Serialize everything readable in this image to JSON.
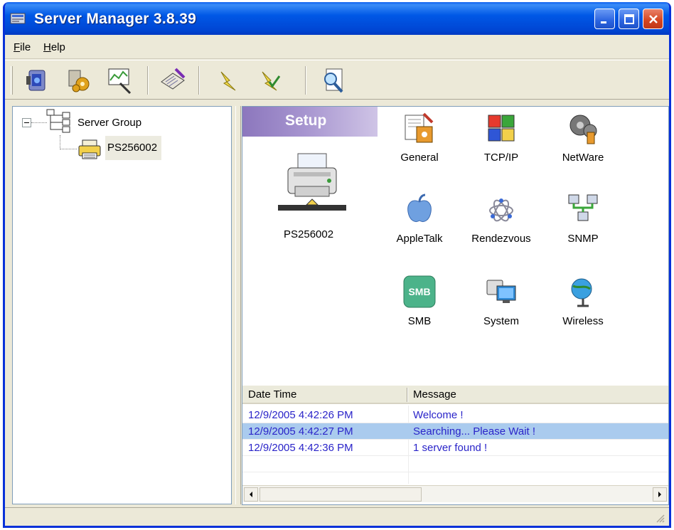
{
  "window": {
    "title": "Server Manager 3.8.39"
  },
  "menu": {
    "file_label": "File",
    "file_mnemonic": "F",
    "file_rest": "ile",
    "help_label": "Help",
    "help_mnemonic": "H",
    "help_rest": "elp"
  },
  "toolbar": {
    "tools": [
      "connect-icon",
      "config-icon",
      "monitor-icon",
      "print-queue-icon",
      "flash-icon",
      "flash-check-icon",
      "search-icon"
    ]
  },
  "tree": {
    "group_label": "Server Group",
    "server_label": "PS256002"
  },
  "setup": {
    "banner": "Setup",
    "server_name": "PS256002",
    "items": [
      {
        "label": "General",
        "icon": "general-icon"
      },
      {
        "label": "TCP/IP",
        "icon": "tcpip-icon"
      },
      {
        "label": "NetWare",
        "icon": "netware-icon"
      },
      {
        "label": "AppleTalk",
        "icon": "appletalk-icon"
      },
      {
        "label": "Rendezvous",
        "icon": "rendezvous-icon"
      },
      {
        "label": "SNMP",
        "icon": "snmp-icon"
      },
      {
        "label": "SMB",
        "icon": "smb-icon"
      },
      {
        "label": "System",
        "icon": "system-icon"
      },
      {
        "label": "Wireless",
        "icon": "wireless-icon"
      }
    ],
    "smb_icon_text": "SMB"
  },
  "log": {
    "columns": [
      "Date Time",
      "Message"
    ],
    "rows": [
      {
        "datetime": "12/9/2005 4:42:26 PM",
        "message": "Welcome !"
      },
      {
        "datetime": "12/9/2005 4:42:27 PM",
        "message": "Searching... Please Wait !"
      },
      {
        "datetime": "12/9/2005 4:42:36 PM",
        "message": "1 server found !"
      }
    ]
  },
  "colors": {
    "titlebar": "#0058e6",
    "log_text": "#2a24c9",
    "selected_row": "#aacbee",
    "setup_banner": "#a694cf"
  }
}
